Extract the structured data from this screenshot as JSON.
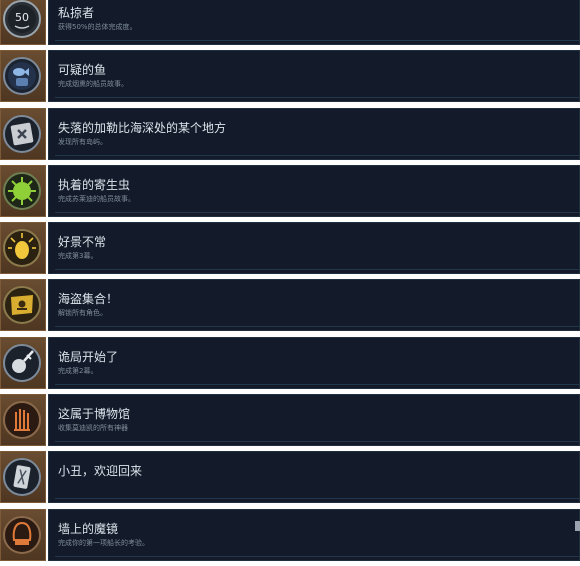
{
  "achievements": [
    {
      "title": "私掠者",
      "desc": "获得50%的总体完成度。",
      "icon": "badge-50-icon"
    },
    {
      "title": "可疑的鱼",
      "desc": "完成烟熏的船员故事。",
      "icon": "fish-crew-icon"
    },
    {
      "title": "失落的加勒比海深处的某个地方",
      "desc": "发现所有岛屿。",
      "icon": "map-x-icon"
    },
    {
      "title": "执着的寄生虫",
      "desc": "完成苏莱迪的船员故事。",
      "icon": "parasite-icon"
    },
    {
      "title": "好景不常",
      "desc": "完成第3幕。",
      "icon": "glowing-lantern-icon"
    },
    {
      "title": "海盗集合！",
      "desc": "解锁所有角色。",
      "icon": "pirate-flag-icon"
    },
    {
      "title": "诡局开始了",
      "desc": "完成第2幕。",
      "icon": "sword-orb-icon"
    },
    {
      "title": "这属于博物馆",
      "desc": "收集莫迪凯的所有神器",
      "icon": "artifact-hand-icon"
    },
    {
      "title": "小丑，欢迎回来",
      "desc": "",
      "icon": "card-icon"
    },
    {
      "title": "墙上的魔镜",
      "desc": "完成你的第一项船长的考验。",
      "icon": "magic-mirror-icon"
    }
  ]
}
